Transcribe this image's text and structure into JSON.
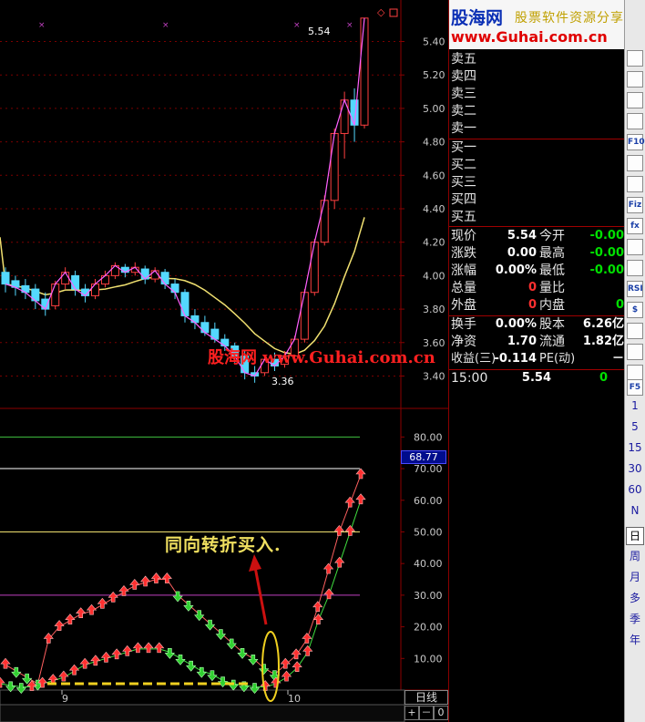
{
  "logo": {
    "brand": "股海网",
    "tagline": "股票软件资源分享",
    "url": "www.Guhai.com.cn"
  },
  "watermark": "股海网 www.Guhai.com.cn",
  "annotation": "同向转折买入.",
  "price_high_label": "5.54",
  "price_low_label": "3.36",
  "indicator_current_value": "68.77",
  "order_book": {
    "sells": [
      "卖五",
      "卖四",
      "卖三",
      "卖二",
      "卖一"
    ],
    "buys": [
      "买一",
      "买二",
      "买三",
      "买四",
      "买五"
    ]
  },
  "quote": [
    {
      "l1": "现价",
      "v1": "5.54",
      "c1": "white",
      "l2": "今开",
      "v2": "-0.00",
      "c2": "green"
    },
    {
      "l1": "涨跌",
      "v1": "0.00",
      "c1": "white",
      "l2": "最高",
      "v2": "-0.00",
      "c2": "green"
    },
    {
      "l1": "涨幅",
      "v1": "0.00%",
      "c1": "white",
      "l2": "最低",
      "v2": "-0.00",
      "c2": "green"
    },
    {
      "l1": "总量",
      "v1": "0",
      "c1": "red",
      "l2": "量比",
      "v2": "",
      "c2": "white"
    },
    {
      "l1": "外盘",
      "v1": "0",
      "c1": "red",
      "l2": "内盘",
      "v2": "0",
      "c2": "green"
    }
  ],
  "fundamentals": [
    {
      "l1": "换手",
      "v1": "0.00%",
      "l2": "股本",
      "v2": "6.26亿"
    },
    {
      "l1": "净资",
      "v1": "1.70",
      "l2": "流通",
      "v2": "1.82亿"
    },
    {
      "l1": "收益(三)",
      "v1": "-0.114",
      "l2": "PE(动)",
      "v2": "－"
    }
  ],
  "tick": {
    "time": "15:00",
    "price": "5.54",
    "vol": "0"
  },
  "toolbar": {
    "icons": [
      "line-chart-icon",
      "kline-icon",
      "table-icon",
      "list-icon",
      "f10-icon",
      "document-icon",
      "info-icon",
      "fiz-icon",
      "function-icon",
      "search-icon",
      "indicator-icon",
      "rsi-icon",
      "dollar-icon",
      "move-icon",
      "arrows-icon",
      "pencil-icon"
    ],
    "icon_texts": [
      "",
      "",
      "",
      "",
      "F10",
      "",
      "",
      "Fiz",
      "fx",
      "",
      "",
      "RSI",
      "$",
      "",
      "",
      ""
    ],
    "f5": "F5",
    "periods": [
      "1",
      "5",
      "15",
      "30",
      "60",
      "N"
    ],
    "day": "日",
    "others": [
      "周",
      "月",
      "多",
      "季",
      "年"
    ]
  },
  "bottom": {
    "period_label": "日线",
    "zoom_in": "+",
    "zoom_out": "－",
    "zero": "0",
    "x_ticks": [
      "9",
      "10"
    ]
  },
  "chart_data": [
    {
      "type": "candlestick",
      "title": "",
      "ylim": [
        3.25,
        5.55
      ],
      "y_ticks": [
        "5.40",
        "5.20",
        "5.00",
        "4.80",
        "4.60",
        "4.40",
        "4.20",
        "4.00",
        "3.80",
        "3.60",
        "3.40"
      ],
      "candles": [
        {
          "o": 4.02,
          "c": 3.95,
          "h": 4.05,
          "l": 3.9
        },
        {
          "o": 3.97,
          "c": 3.93,
          "h": 4.0,
          "l": 3.88
        },
        {
          "o": 3.94,
          "c": 3.9,
          "h": 3.98,
          "l": 3.86
        },
        {
          "o": 3.92,
          "c": 3.85,
          "h": 3.95,
          "l": 3.8
        },
        {
          "o": 3.86,
          "c": 3.8,
          "h": 3.9,
          "l": 3.76
        },
        {
          "o": 3.82,
          "c": 3.95,
          "h": 3.97,
          "l": 3.8
        },
        {
          "o": 3.95,
          "c": 4.02,
          "h": 4.05,
          "l": 3.92
        },
        {
          "o": 4.0,
          "c": 3.92,
          "h": 4.03,
          "l": 3.88
        },
        {
          "o": 3.92,
          "c": 3.88,
          "h": 3.95,
          "l": 3.84
        },
        {
          "o": 3.88,
          "c": 3.95,
          "h": 3.98,
          "l": 3.86
        },
        {
          "o": 3.95,
          "c": 4.0,
          "h": 4.03,
          "l": 3.93
        },
        {
          "o": 4.0,
          "c": 4.06,
          "h": 4.08,
          "l": 3.98
        },
        {
          "o": 4.05,
          "c": 4.02,
          "h": 4.07,
          "l": 3.99
        },
        {
          "o": 4.02,
          "c": 4.05,
          "h": 4.08,
          "l": 4.0
        },
        {
          "o": 4.04,
          "c": 3.98,
          "h": 4.06,
          "l": 3.95
        },
        {
          "o": 3.98,
          "c": 4.03,
          "h": 4.05,
          "l": 3.96
        },
        {
          "o": 4.02,
          "c": 3.95,
          "h": 4.04,
          "l": 3.92
        },
        {
          "o": 3.95,
          "c": 3.9,
          "h": 3.98,
          "l": 3.86
        },
        {
          "o": 3.9,
          "c": 3.76,
          "h": 3.92,
          "l": 3.72
        },
        {
          "o": 3.76,
          "c": 3.72,
          "h": 3.8,
          "l": 3.68
        },
        {
          "o": 3.72,
          "c": 3.66,
          "h": 3.76,
          "l": 3.64
        },
        {
          "o": 3.68,
          "c": 3.62,
          "h": 3.72,
          "l": 3.6
        },
        {
          "o": 3.62,
          "c": 3.58,
          "h": 3.65,
          "l": 3.55
        },
        {
          "o": 3.58,
          "c": 3.52,
          "h": 3.6,
          "l": 3.48
        },
        {
          "o": 3.52,
          "c": 3.42,
          "h": 3.55,
          "l": 3.38
        },
        {
          "o": 3.42,
          "c": 3.4,
          "h": 3.46,
          "l": 3.36
        },
        {
          "o": 3.42,
          "c": 3.5,
          "h": 3.52,
          "l": 3.4
        },
        {
          "o": 3.5,
          "c": 3.46,
          "h": 3.54,
          "l": 3.43
        },
        {
          "o": 3.47,
          "c": 3.52,
          "h": 3.55,
          "l": 3.45
        },
        {
          "o": 3.52,
          "c": 3.62,
          "h": 3.64,
          "l": 3.5
        },
        {
          "o": 3.62,
          "c": 3.9,
          "h": 3.92,
          "l": 3.6
        },
        {
          "o": 3.9,
          "c": 4.2,
          "h": 4.22,
          "l": 3.88
        },
        {
          "o": 4.2,
          "c": 4.45,
          "h": 4.48,
          "l": 4.18
        },
        {
          "o": 4.45,
          "c": 4.85,
          "h": 4.88,
          "l": 4.4
        },
        {
          "o": 4.85,
          "c": 5.05,
          "h": 5.1,
          "l": 4.7
        },
        {
          "o": 5.05,
          "c": 4.9,
          "h": 5.12,
          "l": 4.8
        },
        {
          "o": 4.9,
          "c": 5.54,
          "h": 5.54,
          "l": 4.88
        }
      ]
    },
    {
      "type": "line",
      "title": "",
      "ylim": [
        0,
        85
      ],
      "y_ticks": [
        "80.00",
        "70.00",
        "60.00",
        "50.00",
        "40.00",
        "30.00",
        "20.00",
        "10.00"
      ],
      "hlines": [
        80,
        70,
        50,
        30
      ],
      "series": [
        {
          "values": [
            8,
            6,
            4,
            2,
            16,
            20,
            22,
            24,
            25,
            27,
            29,
            31,
            33,
            34,
            35,
            35,
            30,
            27,
            24,
            21,
            18,
            15,
            12,
            10,
            7,
            5,
            8,
            11,
            16,
            26,
            38,
            50,
            59,
            68
          ]
        },
        {
          "values": [
            2,
            1.5,
            1,
            1,
            2,
            3,
            4,
            6,
            8,
            9,
            10,
            11,
            12,
            13,
            13,
            13,
            12,
            10,
            8,
            6,
            5,
            3,
            2,
            1.5,
            1,
            1,
            2,
            4,
            7,
            12,
            22,
            30,
            40,
            50,
            60
          ]
        }
      ]
    }
  ]
}
